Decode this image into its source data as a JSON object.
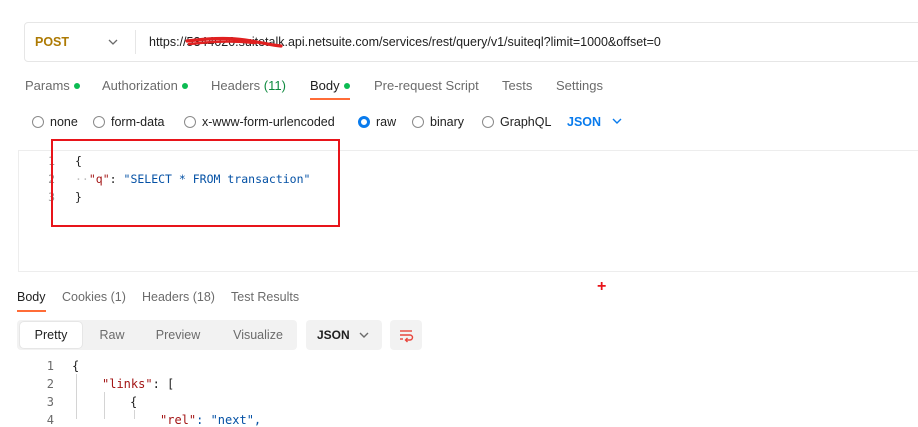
{
  "request": {
    "method": "POST",
    "url": "https://5344020.suitetalk.api.netsuite.com/services/rest/query/v1/suiteql?limit=1000&offset=0"
  },
  "request_tabs": [
    {
      "label": "Params",
      "dot": true
    },
    {
      "label": "Authorization",
      "dot": true
    },
    {
      "label": "Headers",
      "count": "(11)"
    },
    {
      "label": "Body",
      "dot": true,
      "active": true
    },
    {
      "label": "Pre-request Script"
    },
    {
      "label": "Tests"
    },
    {
      "label": "Settings"
    }
  ],
  "body_types": [
    "none",
    "form-data",
    "x-www-form-urlencoded",
    "raw",
    "binary",
    "GraphQL"
  ],
  "body_type_selected": "raw",
  "body_format": "JSON",
  "editor": {
    "line_numbers": [
      "1",
      "2",
      "3"
    ],
    "line1": "{",
    "key": "\"q\"",
    "colon": ":",
    "value": "\"SELECT * FROM transaction\"",
    "line3": "}"
  },
  "response_tabs": [
    {
      "label": "Body",
      "active": true
    },
    {
      "label": "Cookies (1)"
    },
    {
      "label": "Headers (18)"
    },
    {
      "label": "Test Results"
    }
  ],
  "view_modes": [
    "Pretty",
    "Raw",
    "Preview",
    "Visualize"
  ],
  "view_mode_selected": "Pretty",
  "response_format": "JSON",
  "response": {
    "line_numbers": [
      "1",
      "2",
      "3",
      "4"
    ],
    "line1": "{",
    "line2_key": "\"links\"",
    "line2_rest": ": [",
    "line3": "{",
    "line4_key": "\"rel\"",
    "line4_rest": ": \"next\","
  },
  "colors": {
    "accent": "#ff6c37",
    "method": "#ad7a03",
    "selected": "#097bed",
    "annotation": "#e8141a"
  }
}
